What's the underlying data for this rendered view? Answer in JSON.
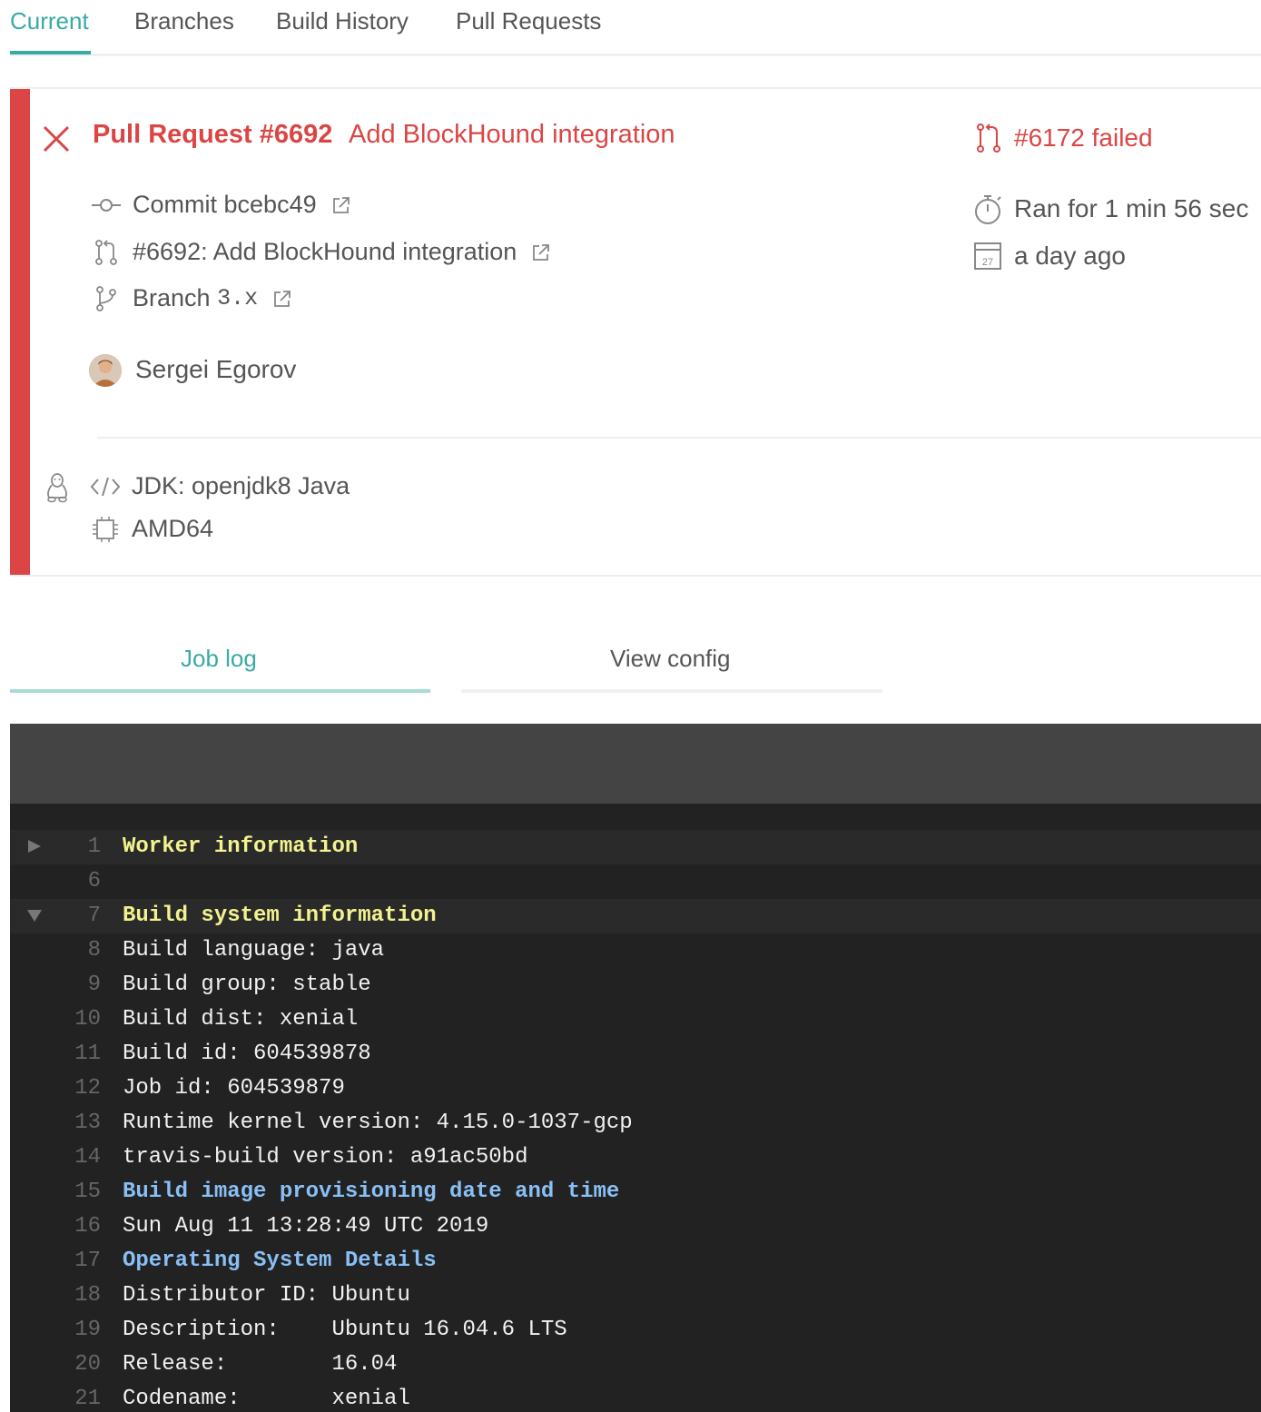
{
  "tabs": [
    {
      "label": "Current",
      "active": true
    },
    {
      "label": "Branches",
      "active": false
    },
    {
      "label": "Build History",
      "active": false
    },
    {
      "label": "Pull Requests",
      "active": false
    }
  ],
  "build": {
    "status": "failed",
    "status_color": "#db4545",
    "pr_title": "Pull Request #6692",
    "pr_message": "Add BlockHound integration",
    "commit_label": "Commit",
    "commit_sha": "bcebc49",
    "pr_link": "#6692: Add BlockHound integration",
    "branch_label": "Branch",
    "branch_name": "3.x",
    "author": "Sergei Egorov",
    "build_number": "#6172 failed",
    "duration": "Ran for 1 min 56 sec",
    "finished": "a day ago",
    "calendar_day": "27",
    "jdk": "JDK: openjdk8 Java",
    "arch": "AMD64"
  },
  "log_tabs": [
    {
      "label": "Job log",
      "active": true
    },
    {
      "label": "View config",
      "active": false
    }
  ],
  "accent_color": "#39aaa4",
  "log": [
    {
      "n": "1",
      "text": "Worker information",
      "style": "yellow",
      "fold": "collapsed"
    },
    {
      "n": "6",
      "text": "",
      "style": "plain",
      "fold": "none"
    },
    {
      "n": "7",
      "text": "Build system information",
      "style": "yellow",
      "fold": "expanded"
    },
    {
      "n": "8",
      "text": "Build language: java",
      "style": "plain",
      "fold": "none"
    },
    {
      "n": "9",
      "text": "Build group: stable",
      "style": "plain",
      "fold": "none"
    },
    {
      "n": "10",
      "text": "Build dist: xenial",
      "style": "plain",
      "fold": "none"
    },
    {
      "n": "11",
      "text": "Build id: 604539878",
      "style": "plain",
      "fold": "none"
    },
    {
      "n": "12",
      "text": "Job id: 604539879",
      "style": "plain",
      "fold": "none"
    },
    {
      "n": "13",
      "text": "Runtime kernel version: 4.15.0-1037-gcp",
      "style": "plain",
      "fold": "none"
    },
    {
      "n": "14",
      "text": "travis-build version: a91ac50bd",
      "style": "plain",
      "fold": "none"
    },
    {
      "n": "15",
      "text": "Build image provisioning date and time",
      "style": "blue",
      "fold": "none"
    },
    {
      "n": "16",
      "text": "Sun Aug 11 13:28:49 UTC 2019",
      "style": "plain",
      "fold": "none"
    },
    {
      "n": "17",
      "text": "Operating System Details",
      "style": "blue",
      "fold": "none"
    },
    {
      "n": "18",
      "text": "Distributor ID: Ubuntu",
      "style": "plain",
      "fold": "none"
    },
    {
      "n": "19",
      "text": "Description:    Ubuntu 16.04.6 LTS",
      "style": "plain",
      "fold": "none"
    },
    {
      "n": "20",
      "text": "Release:        16.04",
      "style": "plain",
      "fold": "none"
    },
    {
      "n": "21",
      "text": "Codename:       xenial",
      "style": "plain",
      "fold": "none"
    }
  ]
}
